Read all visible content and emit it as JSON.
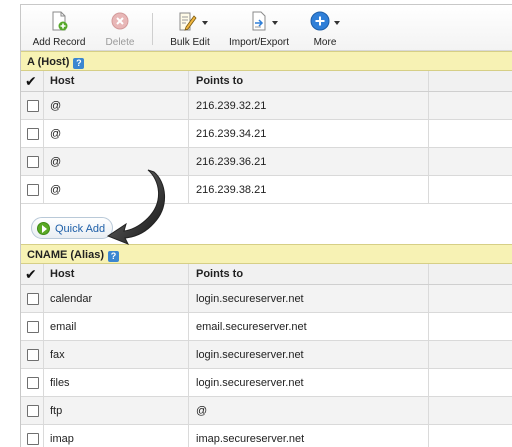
{
  "toolbar": {
    "add_record": "Add Record",
    "delete": "Delete",
    "bulk_edit": "Bulk Edit",
    "import_export": "Import/Export",
    "more": "More"
  },
  "a_section": {
    "title": "A (Host)",
    "columns": {
      "host": "Host",
      "points_to": "Points to"
    },
    "rows": [
      {
        "host": "@",
        "points_to": "216.239.32.21"
      },
      {
        "host": "@",
        "points_to": "216.239.34.21"
      },
      {
        "host": "@",
        "points_to": "216.239.36.21"
      },
      {
        "host": "@",
        "points_to": "216.239.38.21"
      }
    ],
    "quick_add": "Quick Add"
  },
  "cname_section": {
    "title": "CNAME (Alias)",
    "columns": {
      "host": "Host",
      "points_to": "Points to"
    },
    "rows": [
      {
        "host": "calendar",
        "points_to": "login.secureserver.net"
      },
      {
        "host": "email",
        "points_to": "email.secureserver.net"
      },
      {
        "host": "fax",
        "points_to": "login.secureserver.net"
      },
      {
        "host": "files",
        "points_to": "login.secureserver.net"
      },
      {
        "host": "ftp",
        "points_to": "@"
      },
      {
        "host": "imap",
        "points_to": "imap.secureserver.net"
      }
    ]
  },
  "icons": {
    "help": "help-icon",
    "add_record": "add-record-icon",
    "delete": "delete-icon",
    "bulk_edit": "bulk-edit-icon",
    "import_export": "import-export-icon",
    "more": "more-icon",
    "quick_add": "play-icon"
  },
  "colors": {
    "section_header": "#f7f2b4",
    "link": "#1e5fa8",
    "quick_add_icon": "#5aa925",
    "more_icon": "#2f7fd8"
  }
}
